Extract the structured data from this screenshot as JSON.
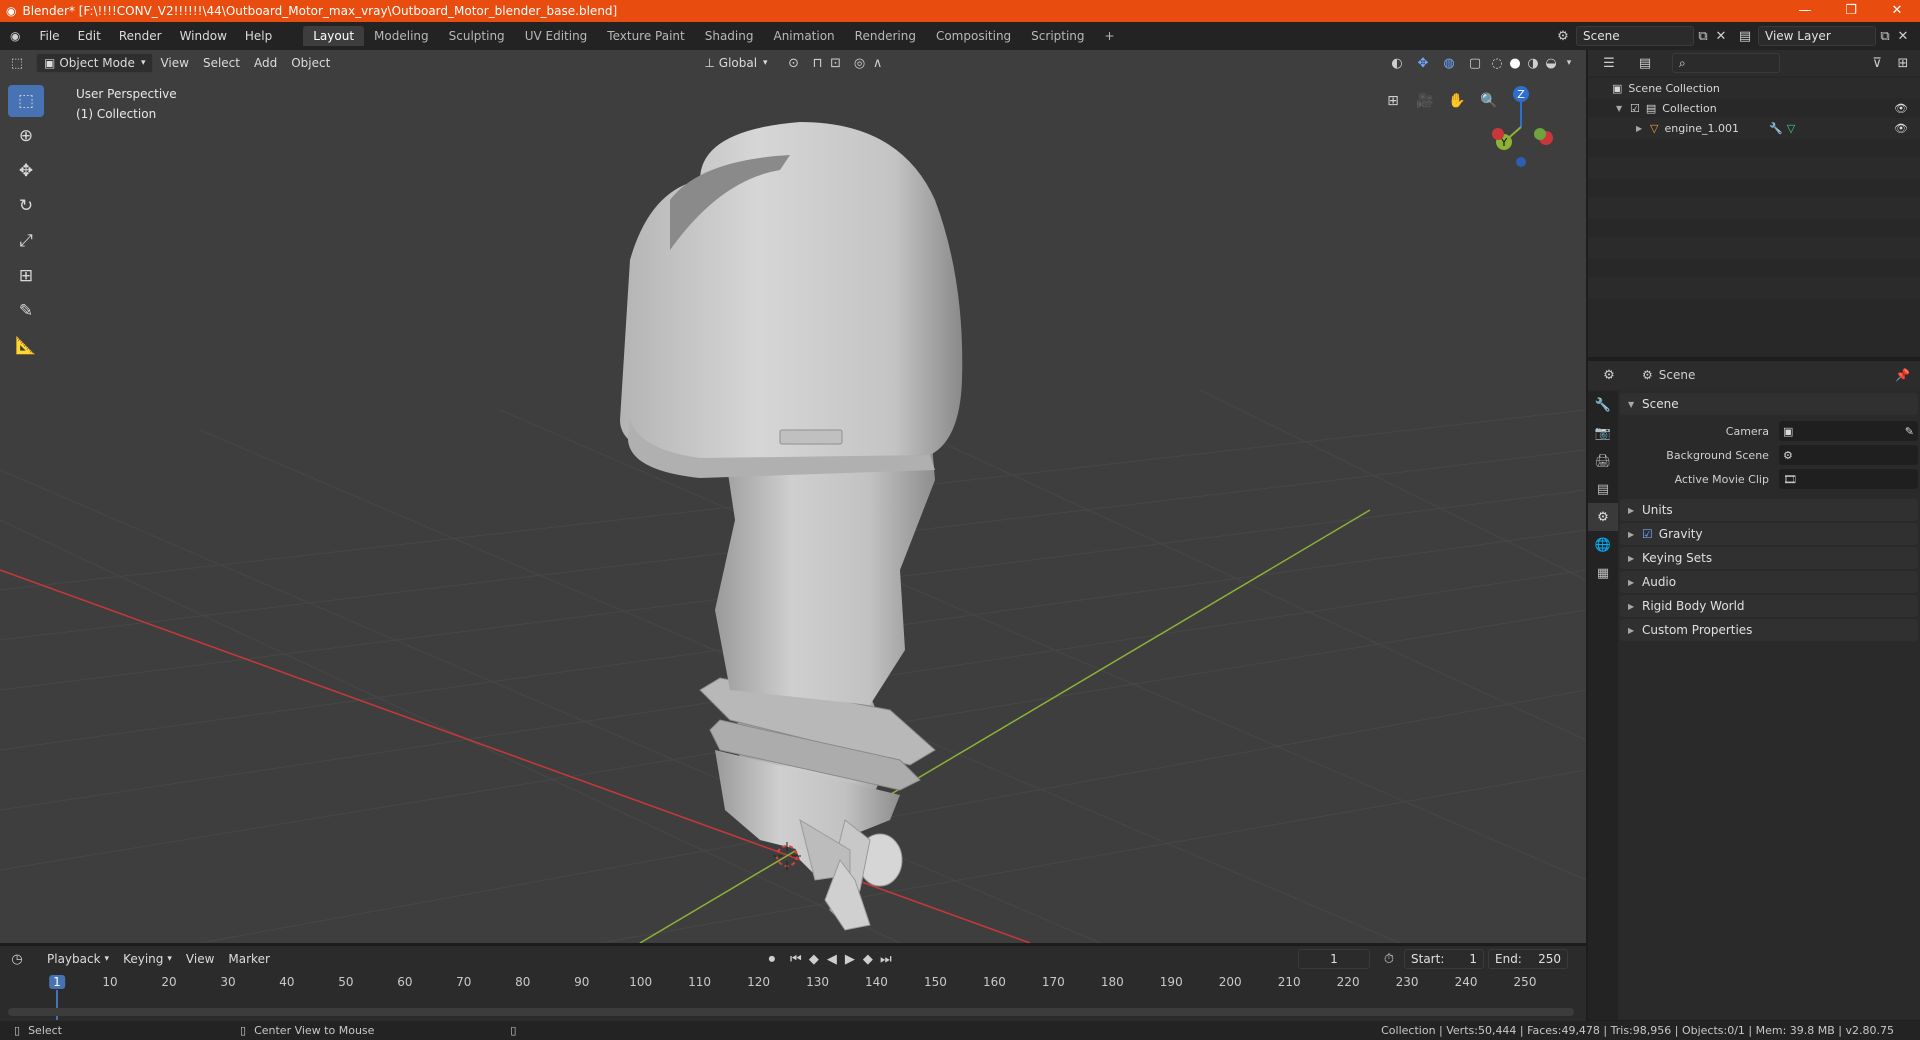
{
  "window": {
    "title": "Blender* [F:\\!!!!CONV_V2!!!!!!\\44\\Outboard_Motor_max_vray\\Outboard_Motor_blender_base.blend]"
  },
  "menu": [
    "File",
    "Edit",
    "Render",
    "Window",
    "Help"
  ],
  "workspaces": [
    "Layout",
    "Modeling",
    "Sculpting",
    "UV Editing",
    "Texture Paint",
    "Shading",
    "Animation",
    "Rendering",
    "Compositing",
    "Scripting"
  ],
  "active_workspace": "Layout",
  "scene_selector": {
    "value": "Scene"
  },
  "view_layer_selector": {
    "value": "View Layer"
  },
  "viewport": {
    "mode": "Object Mode",
    "header_menus": [
      "View",
      "Select",
      "Add",
      "Object"
    ],
    "transform_orientation": "Global",
    "overlay_text": [
      "User Perspective",
      "(1) Collection"
    ],
    "gizmo_axes": {
      "z": "Z",
      "y": "Y"
    }
  },
  "timeline": {
    "menus": [
      "Playback",
      "Keying",
      "View",
      "Marker"
    ],
    "current_frame": "1",
    "start_label": "Start:",
    "start_value": "1",
    "end_label": "End:",
    "end_value": "250",
    "ruler_ticks": [
      "1",
      "10",
      "20",
      "30",
      "40",
      "50",
      "60",
      "70",
      "80",
      "90",
      "100",
      "110",
      "120",
      "130",
      "140",
      "150",
      "160",
      "170",
      "180",
      "190",
      "200",
      "210",
      "220",
      "230",
      "240",
      "250"
    ]
  },
  "status_bar": {
    "left_action": "Select",
    "middle_action": "Center View to Mouse",
    "stats": "Collection | Verts:50,444 | Faces:49,478 | Tris:98,956 | Objects:0/1 | Mem: 39.8 MB | v2.80.75"
  },
  "outliner": {
    "root": "Scene Collection",
    "collection": "Collection",
    "object": "engine_1.001"
  },
  "properties": {
    "context_title": "Scene",
    "section_scene": "Scene",
    "camera_label": "Camera",
    "background_scene_label": "Background Scene",
    "active_movie_clip_label": "Active Movie Clip",
    "panels": [
      "Units",
      "Gravity",
      "Keying Sets",
      "Audio",
      "Rigid Body World",
      "Custom Properties"
    ]
  },
  "colors": {
    "title_bar": "#e84c0e",
    "viewport_bg": "#3e3e3e",
    "active_tool": "#4772b3",
    "x_axis": "#c9373a",
    "y_axis": "#8cb236",
    "z_axis": "#2c6fd1"
  }
}
